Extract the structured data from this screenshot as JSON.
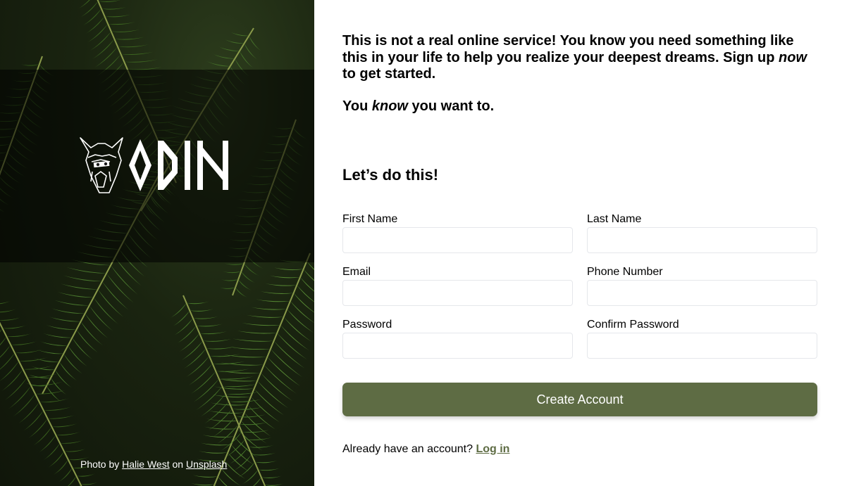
{
  "hero": {
    "logo_text": "ODIN",
    "credit": {
      "prefix": "Photo by",
      "author": "Halie West",
      "middle": "on",
      "source": "Unsplash"
    }
  },
  "intro": {
    "p1_part1": "This is not a real online service! You know you need something like this in your life to help you realize your deepest dreams. Sign up ",
    "p1_em": "now",
    "p1_part2": " to get started.",
    "p2_part1": "You ",
    "p2_em": "know",
    "p2_part2": " you want to."
  },
  "form": {
    "heading": "Let’s do this!",
    "fields": {
      "first_name": {
        "label": "First Name",
        "value": "",
        "placeholder": ""
      },
      "last_name": {
        "label": "Last Name",
        "value": "",
        "placeholder": ""
      },
      "email": {
        "label": "Email",
        "value": "",
        "placeholder": ""
      },
      "phone": {
        "label": "Phone Number",
        "value": "",
        "placeholder": ""
      },
      "password": {
        "label": "Password",
        "value": "",
        "placeholder": ""
      },
      "confirm_password": {
        "label": "Confirm Password",
        "value": "",
        "placeholder": ""
      }
    },
    "submit_label": "Create Account",
    "login_prompt": "Already have an account?",
    "login_link": "Log in"
  },
  "colors": {
    "accent": "#5e6c44",
    "background": "#ffffff",
    "text": "#000000"
  }
}
